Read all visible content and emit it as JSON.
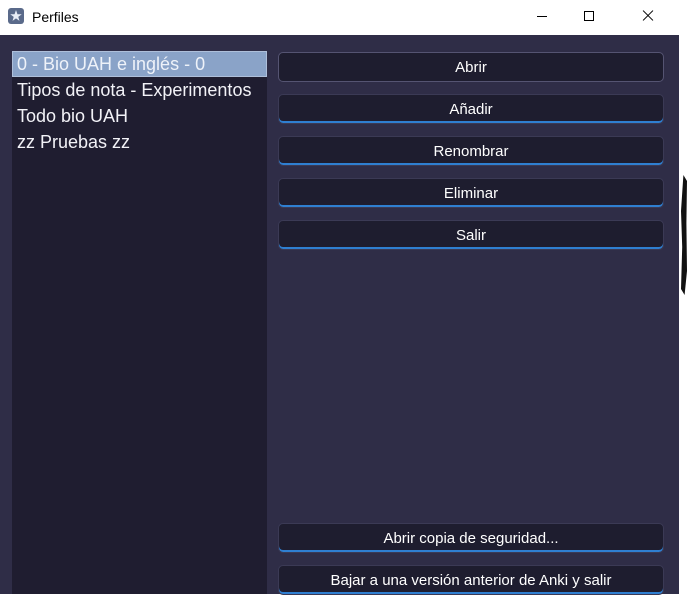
{
  "window": {
    "title": "Perfiles"
  },
  "profiles": [
    {
      "label": "0 - Bio UAH e inglés - 0",
      "selected": true
    },
    {
      "label": "Tipos de nota - Experimentos",
      "selected": false
    },
    {
      "label": "Todo bio UAH",
      "selected": false
    },
    {
      "label": "zz Pruebas zz",
      "selected": false
    }
  ],
  "buttons": {
    "open": "Abrir",
    "add": "Añadir",
    "rename": "Renombrar",
    "delete": "Eliminar",
    "quit": "Salir",
    "restore_backup": "Abrir copia de seguridad...",
    "downgrade": "Bajar a una versión anterior de Anki y salir"
  },
  "colors": {
    "background": "#2f2d47",
    "list_background": "#1f1d30",
    "selection": "#8aa3c8",
    "button_accent": "#2f7fd1"
  }
}
